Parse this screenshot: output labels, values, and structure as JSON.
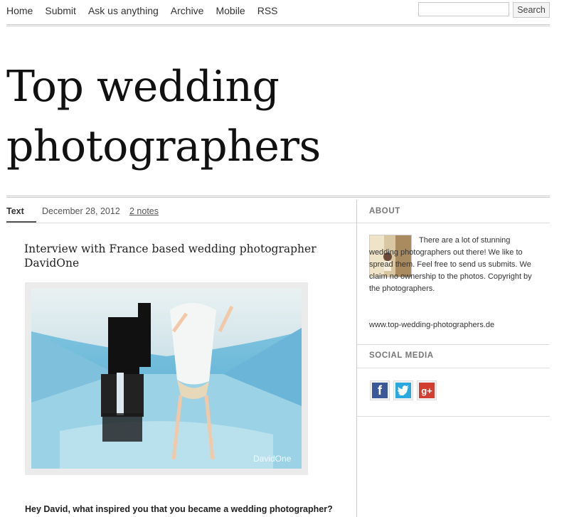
{
  "nav": {
    "items": [
      {
        "label": "Home"
      },
      {
        "label": "Submit"
      },
      {
        "label": "Ask us anything"
      },
      {
        "label": "Archive"
      },
      {
        "label": "Mobile"
      },
      {
        "label": "RSS"
      }
    ],
    "search_button": "Search",
    "search_value": ""
  },
  "site": {
    "title": "Top wedding photographers"
  },
  "post": {
    "type": "Text",
    "date": "December 28, 2012",
    "notes": "2 notes",
    "title": "Interview with France based wedding photographer DavidOne",
    "watermark": "DavidOne",
    "question": "Hey David, what inspired you that you became a wedding photographer?"
  },
  "sidebar": {
    "about": {
      "heading": "ABOUT",
      "text": "There are a lot of stunning wedding photographers out there! We like to spread them. Feel free to send us submits. We claim no ownership to the photos. Copyright by the photographers.",
      "url": "www.top-wedding-photographers.de"
    },
    "social": {
      "heading": "SOCIAL MEDIA",
      "icons": [
        "facebook-icon",
        "twitter-icon",
        "google-plus-icon"
      ]
    }
  },
  "colors": {
    "facebook": "#3b5998",
    "twitter": "#2aa9e0",
    "google_plus": "#d23f31",
    "pool_water": "#5fb3d6"
  }
}
